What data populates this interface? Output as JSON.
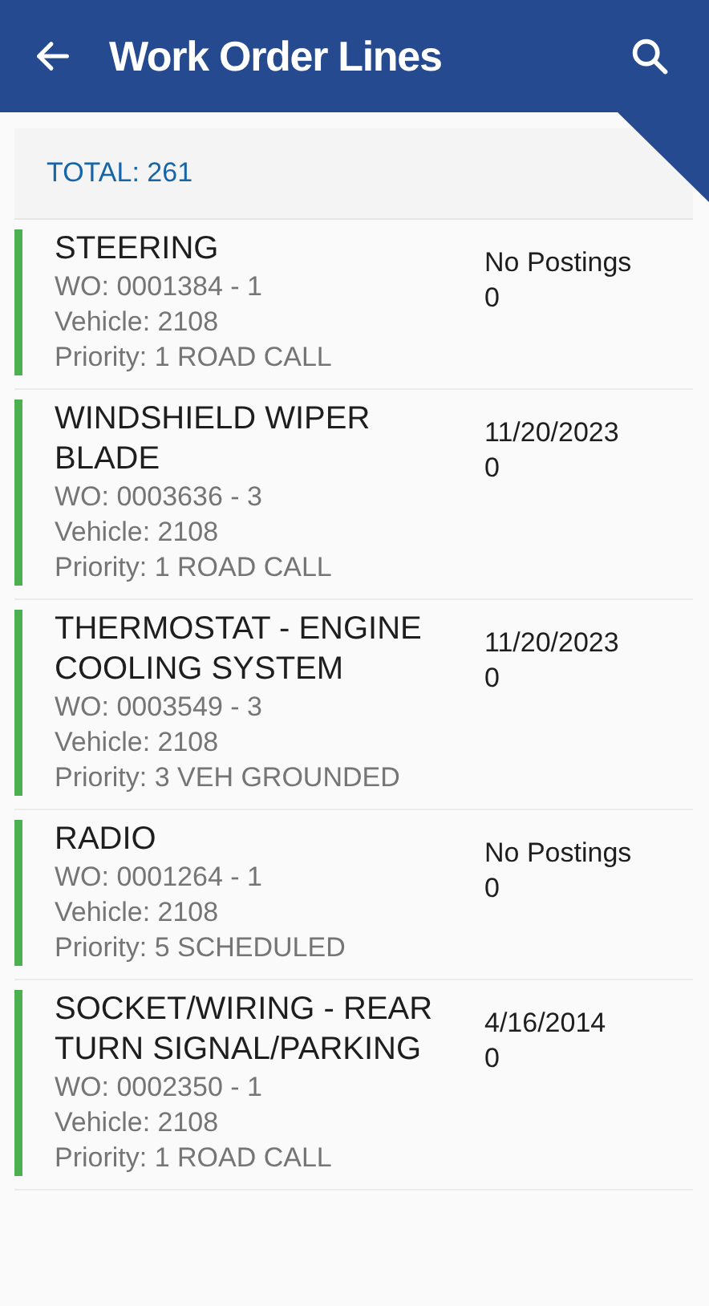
{
  "header": {
    "title": "Work Order Lines"
  },
  "total": "TOTAL: 261",
  "lines": [
    {
      "title": "STEERING",
      "wo": "WO: 0001384 - 1",
      "vehicle": "Vehicle: 2108",
      "priority": "Priority: 1 ROAD CALL",
      "date": "No Postings",
      "count": "0"
    },
    {
      "title": "WINDSHIELD WIPER BLADE",
      "wo": "WO: 0003636 - 3",
      "vehicle": "Vehicle: 2108",
      "priority": "Priority: 1 ROAD CALL",
      "date": "11/20/2023",
      "count": "0"
    },
    {
      "title": "THERMOSTAT - ENGINE COOLING SYSTEM",
      "wo": "WO: 0003549 - 3",
      "vehicle": "Vehicle: 2108",
      "priority": "Priority: 3 VEH GROUNDED",
      "date": "11/20/2023",
      "count": "0"
    },
    {
      "title": "RADIO",
      "wo": "WO: 0001264 - 1",
      "vehicle": "Vehicle: 2108",
      "priority": "Priority: 5 SCHEDULED",
      "date": "No Postings",
      "count": "0"
    },
    {
      "title": "SOCKET/WIRING - REAR TURN SIGNAL/PARKING",
      "wo": "WO: 0002350 - 1",
      "vehicle": "Vehicle: 2108",
      "priority": "Priority: 1 ROAD CALL",
      "date": "4/16/2014",
      "count": "0"
    }
  ]
}
